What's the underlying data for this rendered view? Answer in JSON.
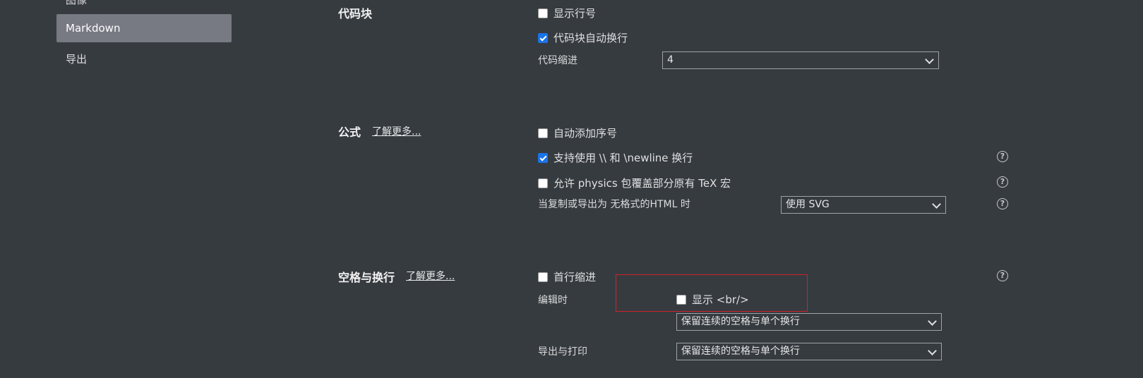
{
  "sidebar": {
    "items": [
      {
        "label": "图像",
        "active": false
      },
      {
        "label": "Markdown",
        "active": true
      },
      {
        "label": "导出",
        "active": false
      }
    ]
  },
  "code_block": {
    "title": "代码块",
    "show_line_numbers": {
      "label": "显示行号",
      "checked": false
    },
    "auto_wrap": {
      "label": "代码块自动换行",
      "checked": true
    },
    "indent": {
      "label": "代码缩进",
      "value": "4"
    }
  },
  "math": {
    "title": "公式",
    "learn_more": "了解更多...",
    "auto_number": {
      "label": "自动添加序号",
      "checked": false
    },
    "newline_support": {
      "label": "支持使用 \\\\ 和 \\newline 换行",
      "checked": true
    },
    "physics": {
      "label": "允许 physics 包覆盖部分原有 TeX 宏",
      "checked": false
    },
    "copy_export": {
      "label": "当复制或导出为 无格式的HTML 时",
      "value": "使用 SVG"
    },
    "help_icon": "?"
  },
  "whitespace": {
    "title": "空格与换行",
    "learn_more": "了解更多...",
    "first_line_indent": {
      "label": "首行缩进",
      "checked": false
    },
    "editing": {
      "label": "编辑时",
      "show_br": {
        "label": "显示 <br/>",
        "checked": false
      },
      "value": "保留连续的空格与单个换行"
    },
    "export_print": {
      "label": "导出与打印",
      "value": "保留连续的空格与单个换行"
    }
  },
  "colors": {
    "background": "#363b40",
    "active_item": "#777983",
    "checkbox_checked": "#1a73e8",
    "highlight": "#d0202a"
  }
}
